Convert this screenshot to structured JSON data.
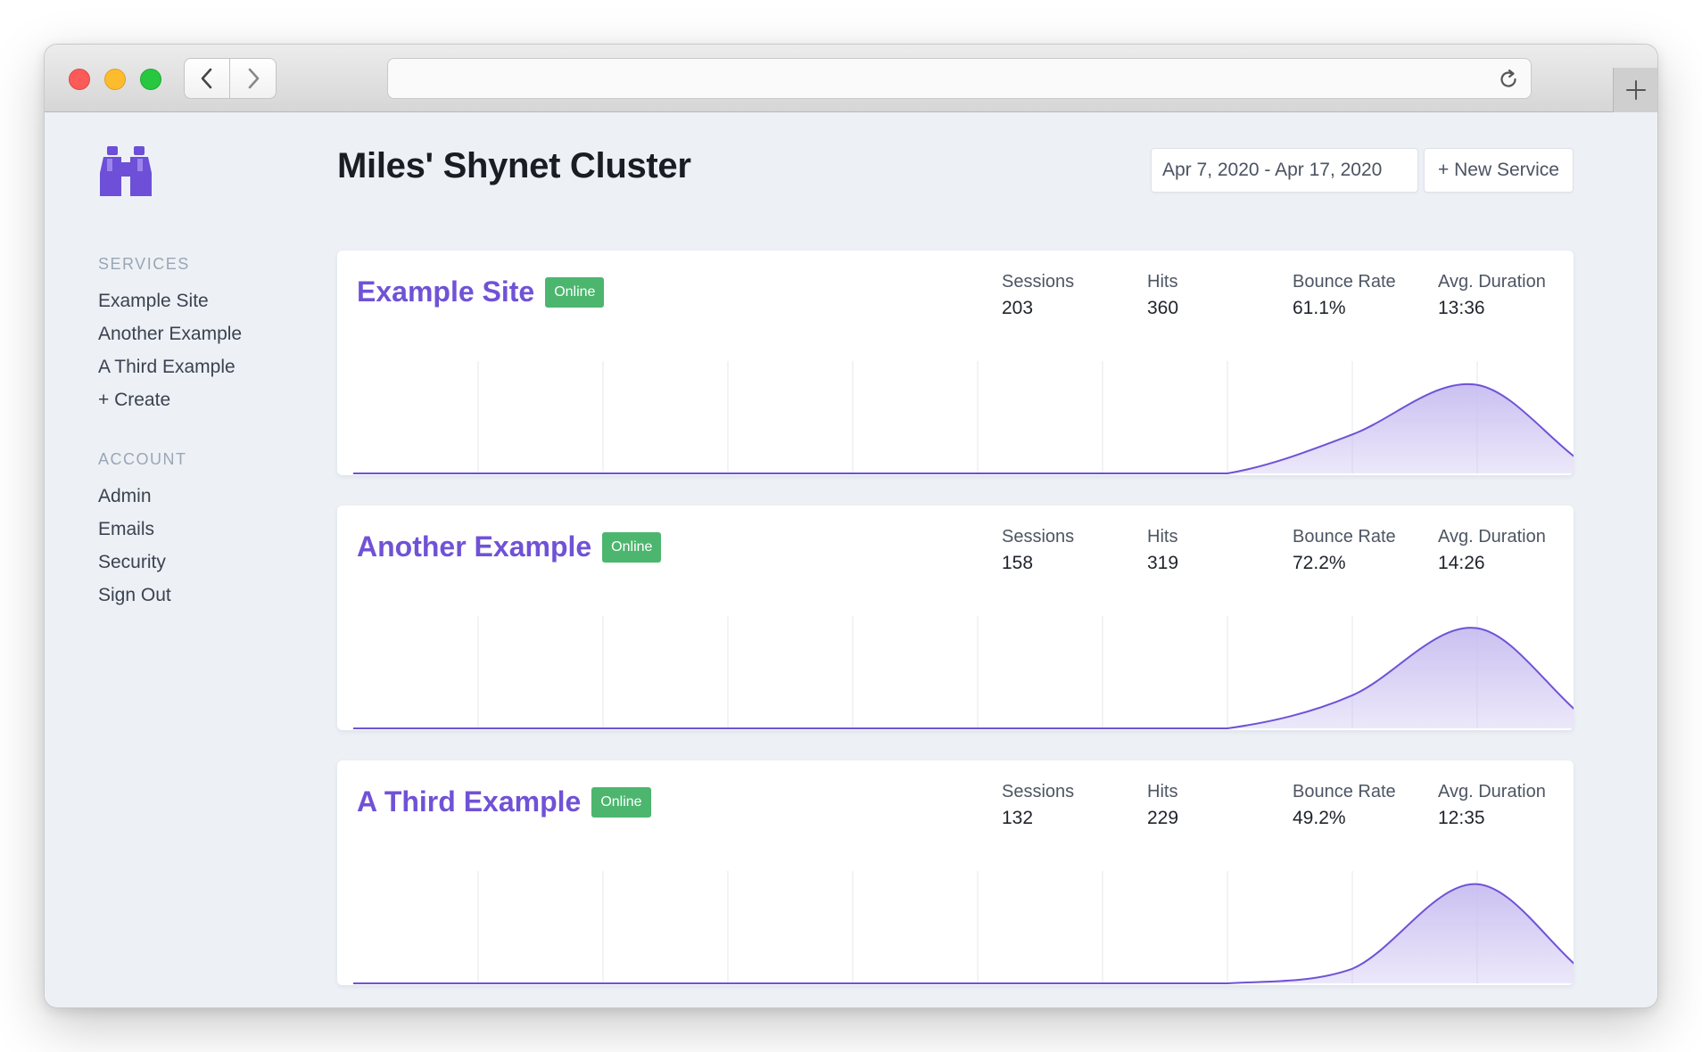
{
  "header": {
    "title": "Miles' Shynet Cluster",
    "date_range": "Apr 7, 2020 - Apr 17, 2020",
    "new_service_label": "+ New Service"
  },
  "sidebar": {
    "services_heading": "SERVICES",
    "services": [
      "Example Site",
      "Another Example",
      "A Third Example",
      "+ Create"
    ],
    "account_heading": "ACCOUNT",
    "account": [
      "Admin",
      "Emails",
      "Security",
      "Sign Out"
    ]
  },
  "colors": {
    "accent": "#7052d6",
    "badge": "#4cb66e",
    "area_fill": "#c8bdf0"
  },
  "icons": [
    "binoculars-icon",
    "chevron-left-icon",
    "chevron-right-icon",
    "reload-icon",
    "plus-icon"
  ],
  "services": [
    {
      "name": "Example Site",
      "status": "Online",
      "sessions_label": "Sessions",
      "sessions": "203",
      "hits_label": "Hits",
      "hits": "360",
      "bounce_label": "Bounce Rate",
      "bounce": "61.1%",
      "duration_label": "Avg. Duration",
      "duration": "13:36"
    },
    {
      "name": "Another Example",
      "status": "Online",
      "sessions_label": "Sessions",
      "sessions": "158",
      "hits_label": "Hits",
      "hits": "319",
      "bounce_label": "Bounce Rate",
      "bounce": "72.2%",
      "duration_label": "Avg. Duration",
      "duration": "14:26"
    },
    {
      "name": "A Third Example",
      "status": "Online",
      "sessions_label": "Sessions",
      "sessions": "132",
      "hits_label": "Hits",
      "hits": "229",
      "bounce_label": "Bounce Rate",
      "bounce": "49.2%",
      "duration_label": "Avg. Duration",
      "duration": "12:35"
    }
  ],
  "chart_data": [
    {
      "type": "area",
      "x_count": 11,
      "values": [
        0,
        0,
        0,
        0,
        0,
        0,
        0,
        0,
        40,
        91,
        0
      ]
    },
    {
      "type": "area",
      "x_count": 11,
      "values": [
        0,
        0,
        0,
        0,
        0,
        0,
        0,
        0,
        34,
        103,
        0
      ]
    },
    {
      "type": "area",
      "x_count": 11,
      "values": [
        0,
        0,
        0,
        0,
        0,
        0,
        0,
        0,
        15,
        102,
        0
      ]
    }
  ]
}
